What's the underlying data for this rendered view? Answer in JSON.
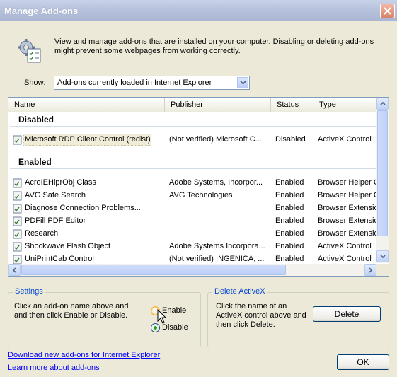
{
  "window": {
    "title": "Manage Add-ons"
  },
  "header": {
    "description": "View and manage add-ons that are installed on your computer. Disabling or deleting add-ons might prevent some webpages from working correctly."
  },
  "show": {
    "label": "Show:",
    "selected": "Add-ons currently loaded in Internet Explorer"
  },
  "list": {
    "columns": [
      "Name",
      "Publisher",
      "Status",
      "Type"
    ],
    "groups": [
      {
        "label": "Disabled",
        "rows": [
          {
            "name": "Microsoft RDP Client Control (redist)",
            "publisher": "(Not verified) Microsoft C...",
            "status": "Disabled",
            "type": "ActiveX Control",
            "selected": true
          }
        ]
      },
      {
        "label": "Enabled",
        "rows": [
          {
            "name": "AcroIEHlprObj Class",
            "publisher": "Adobe Systems, Incorpor...",
            "status": "Enabled",
            "type": "Browser Helper C"
          },
          {
            "name": "AVG Safe Search",
            "publisher": "AVG Technologies",
            "status": "Enabled",
            "type": "Browser Helper C"
          },
          {
            "name": "Diagnose Connection Problems...",
            "publisher": "",
            "status": "Enabled",
            "type": "Browser Extensio"
          },
          {
            "name": "PDFill PDF Editor",
            "publisher": "",
            "status": "Enabled",
            "type": "Browser Extensio"
          },
          {
            "name": "Research",
            "publisher": "",
            "status": "Enabled",
            "type": "Browser Extensio"
          },
          {
            "name": "Shockwave Flash Object",
            "publisher": "Adobe Systems Incorpora...",
            "status": "Enabled",
            "type": "ActiveX Control"
          },
          {
            "name": "UniPrintCab Control",
            "publisher": "(Not verified) INGENICA, ...",
            "status": "Enabled",
            "type": "ActiveX Control"
          }
        ]
      }
    ]
  },
  "settings": {
    "legend": "Settings",
    "text": "Click an add-on name above and and then click Enable or Disable.",
    "enable_label": "Enable",
    "disable_label": "Disable",
    "selected": "Disable"
  },
  "delete_activex": {
    "legend": "Delete ActiveX",
    "text": "Click the name of an ActiveX control above and then click Delete.",
    "button_label": "Delete"
  },
  "links": {
    "download": "Download new add-ons for Internet Explorer",
    "learn": "Learn more about add-ons"
  },
  "ok_label": "OK",
  "colors": {
    "link": "#0000ff",
    "legend": "#0046d5",
    "dialog_bg": "#ece9d8"
  }
}
